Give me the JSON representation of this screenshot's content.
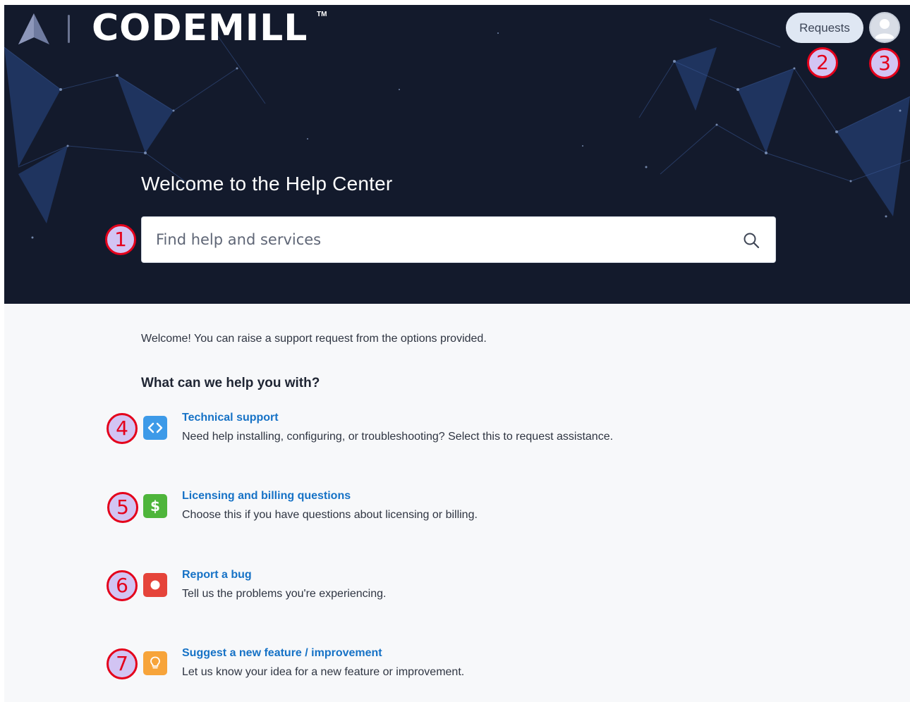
{
  "brand": {
    "name": "CODEMILL",
    "trademark": "TM"
  },
  "header": {
    "requests_label": "Requests",
    "avatar_icon": "user-avatar-icon"
  },
  "hero": {
    "title": "Welcome to the Help Center",
    "search_placeholder": "Find help and services",
    "search_icon": "search-icon"
  },
  "main": {
    "intro": "Welcome! You can raise a support request from the options provided.",
    "section_title": "What can we help you with?",
    "options": [
      {
        "title": "Technical support",
        "description": "Need help installing, configuring, or troubleshooting? Select this to request assistance.",
        "icon": "code-icon",
        "color": "#3d9ae8"
      },
      {
        "title": "Licensing and billing questions",
        "description": "Choose this if you have questions about licensing or billing.",
        "icon": "dollar-icon",
        "color": "#4eb53b"
      },
      {
        "title": "Report a bug",
        "description": "Tell us the problems you're experiencing.",
        "icon": "record-dot-icon",
        "color": "#e5443a"
      },
      {
        "title": "Suggest a new feature / improvement",
        "description": "Let us know your idea for a new feature or improvement.",
        "icon": "lightbulb-icon",
        "color": "#f7a43a"
      }
    ]
  },
  "annotations": [
    "1",
    "2",
    "3",
    "4",
    "5",
    "6",
    "7"
  ],
  "colors": {
    "hero_bg": "#131a2c",
    "link": "#1672c6",
    "annotation_border": "#e4001b",
    "annotation_fill": "#d2c4f3"
  }
}
